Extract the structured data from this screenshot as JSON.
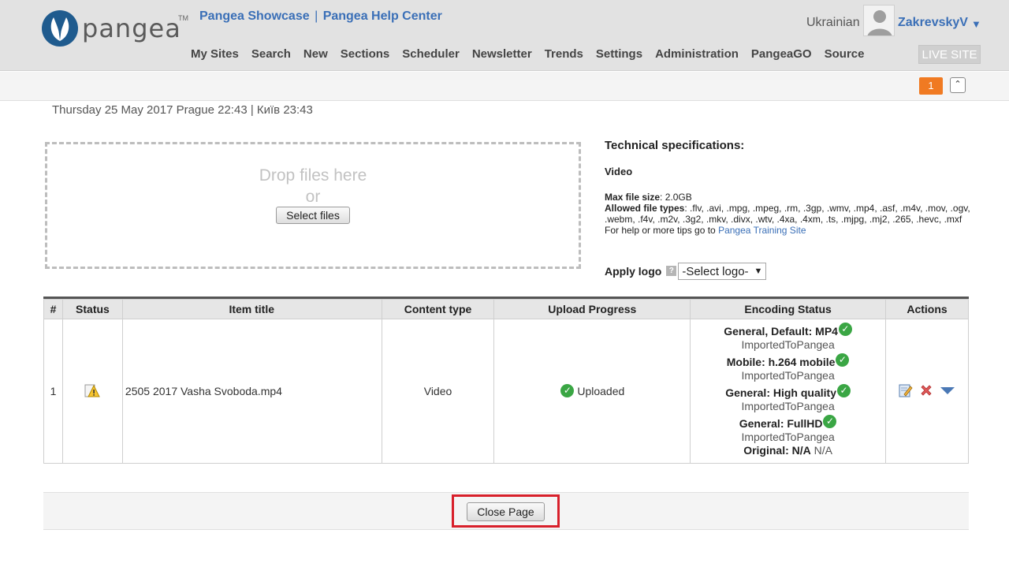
{
  "header": {
    "logo_text": "pangea",
    "logo_tm": "TM",
    "top_links": [
      "Pangea Showcase",
      "Pangea Help Center"
    ],
    "nav": [
      "My Sites",
      "Search",
      "New",
      "Sections",
      "Scheduler",
      "Newsletter",
      "Trends",
      "Settings",
      "Administration",
      "PangeaGO",
      "Source"
    ],
    "language": "Ukrainian",
    "username": "ZakrevskyV",
    "live_site": "LIVE SITE"
  },
  "subbar": {
    "notifications": "1"
  },
  "date_line": "Thursday 25 May 2017 Prague 22:43 | Київ 23:43",
  "dropzone": {
    "drop_text": "Drop files here",
    "or_text": "or",
    "select_files": "Select files"
  },
  "specs": {
    "title": "Technical specifications:",
    "media": "Video",
    "max_size_label": "Max file size",
    "max_size_value": ": 2.0GB",
    "allowed_label": "Allowed file types",
    "allowed_value": ": .flv, .avi, .mpg, .mpeg, .rm, .3gp, .wmv, .mp4, .asf, .m4v, .mov, .ogv, .webm, .f4v, .m2v, .3g2, .mkv, .divx, .wtv, .4xa, .4xm, .ts, .mjpg, .mj2, .265, .hevc, .mxf",
    "help_prefix": "For help or more tips go to ",
    "help_link": "Pangea Training Site",
    "apply_logo_label": "Apply logo",
    "help_icon": "?",
    "logo_select_value": "-Select logo-"
  },
  "table": {
    "headers": [
      "#",
      "Status",
      "Item title",
      "Content type",
      "Upload Progress",
      "Encoding Status",
      "Actions"
    ],
    "rows": [
      {
        "num": "1",
        "status_icon": "warning-icon",
        "title": "2505 2017 Vasha Svoboda.mp4",
        "content_type": "Video",
        "progress": "Uploaded",
        "encodings": [
          {
            "name": "General, Default: MP4",
            "state": "ImportedToPangea"
          },
          {
            "name": "Mobile: h.264 mobile",
            "state": "ImportedToPangea"
          },
          {
            "name": "General: High quality",
            "state": "ImportedToPangea"
          },
          {
            "name": "General: FullHD",
            "state": "ImportedToPangea"
          }
        ],
        "original_label": "Original: N/A",
        "original_value": "N/A"
      }
    ]
  },
  "footer": {
    "close_page": "Close Page"
  },
  "colors": {
    "accent_blue": "#3a6fb7",
    "notif_orange": "#f07a22",
    "success_green": "#3aa644",
    "highlight_red": "#d8202b"
  }
}
